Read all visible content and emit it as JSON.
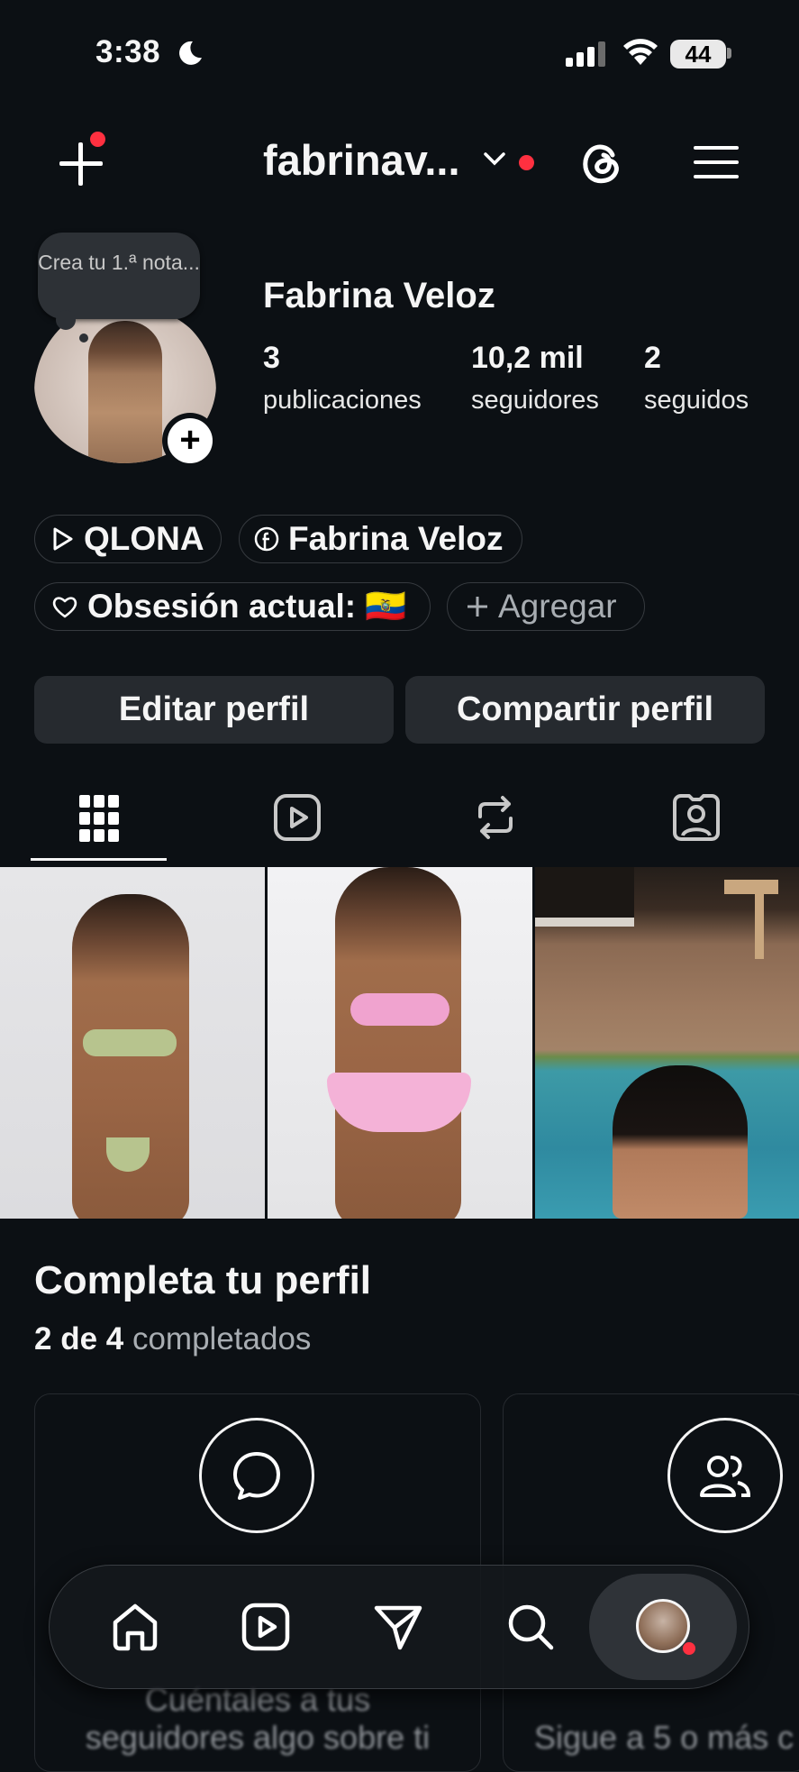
{
  "status": {
    "time": "3:38",
    "battery": "44"
  },
  "header": {
    "username": "fabrinav..."
  },
  "note": {
    "text": "Crea tu 1.ª nota..."
  },
  "profile": {
    "full_name": "Fabrina Veloz",
    "stats": [
      {
        "value": "3",
        "label": "publicaciones"
      },
      {
        "value": "10,2 mil",
        "label": "seguidores"
      },
      {
        "value": "2",
        "label": "seguidos"
      }
    ]
  },
  "links": {
    "qlona": "QLONA",
    "facebook": "Fabrina Veloz",
    "obsession": "Obsesión actual: 🇪🇨",
    "add": "Agregar"
  },
  "actions": {
    "edit": "Editar perfil",
    "share": "Compartir perfil"
  },
  "complete": {
    "title": "Completa tu perfil",
    "progress": "2 de 4",
    "progress_suffix": "completados"
  },
  "cards": [
    {
      "text_line1": "Cuéntales a tus",
      "text_line2": "seguidores algo sobre ti"
    },
    {
      "text_line1": "Sigue a 5 o más c"
    }
  ]
}
